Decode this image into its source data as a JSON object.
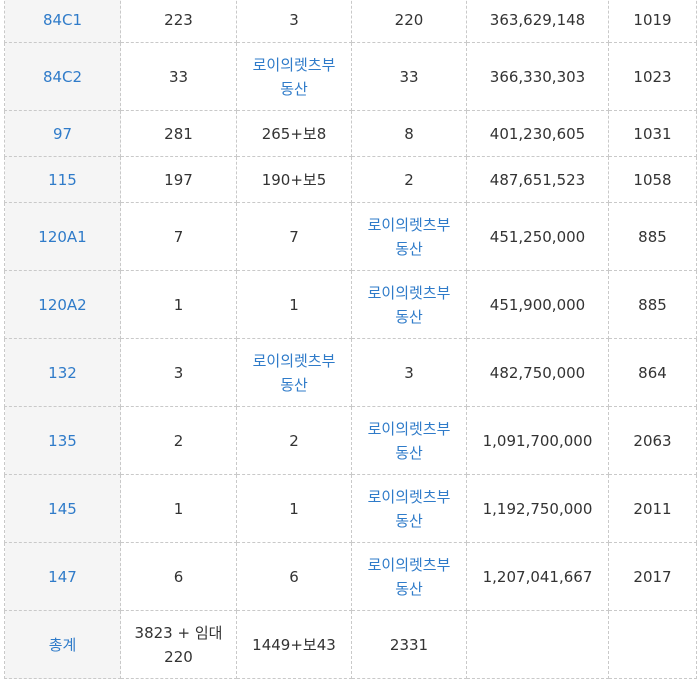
{
  "rows": [
    {
      "type": "84C1",
      "c2": "223",
      "c3": "3",
      "c4": "220",
      "price": "363,629,148",
      "c6": "1019"
    },
    {
      "type": "84C2",
      "c2": "33",
      "c3": [
        "로이의렛츠부",
        "동산"
      ],
      "c4": "33",
      "price": "366,330,303",
      "c6": "1023"
    },
    {
      "type": "97",
      "c2": "281",
      "c3": "265+보8",
      "c4": "8",
      "price": "401,230,605",
      "c6": "1031"
    },
    {
      "type": "115",
      "c2": "197",
      "c3": "190+보5",
      "c4": "2",
      "price": "487,651,523",
      "c6": "1058"
    },
    {
      "type": "120A1",
      "c2": "7",
      "c3": "7",
      "c4": [
        "로이의렛츠부",
        "동산"
      ],
      "price": "451,250,000",
      "c6": "885"
    },
    {
      "type": "120A2",
      "c2": "1",
      "c3": "1",
      "c4": [
        "로이의렛츠부",
        "동산"
      ],
      "price": "451,900,000",
      "c6": "885"
    },
    {
      "type": "132",
      "c2": "3",
      "c3": [
        "로이의렛츠부",
        "동산"
      ],
      "c4": "3",
      "price": "482,750,000",
      "c6": "864"
    },
    {
      "type": "135",
      "c2": "2",
      "c3": "2",
      "c4": [
        "로이의렛츠부",
        "동산"
      ],
      "price": "1,091,700,000",
      "c6": "2063"
    },
    {
      "type": "145",
      "c2": "1",
      "c3": "1",
      "c4": [
        "로이의렛츠부",
        "동산"
      ],
      "price": "1,192,750,000",
      "c6": "2011"
    },
    {
      "type": "147",
      "c2": "6",
      "c3": "6",
      "c4": [
        "로이의렛츠부",
        "동산"
      ],
      "price": "1,207,041,667",
      "c6": "2017"
    }
  ],
  "total": {
    "label": "총계",
    "c2_line1": "3823 + 임대",
    "c2_line2": "220",
    "c3": "1449+보43",
    "c4": "2331",
    "price": "",
    "c6": ""
  },
  "colors": {
    "link": "#2f7bc9",
    "text": "#333333",
    "first_col_bg": "#f5f5f5",
    "border": "#c9c9c9"
  }
}
